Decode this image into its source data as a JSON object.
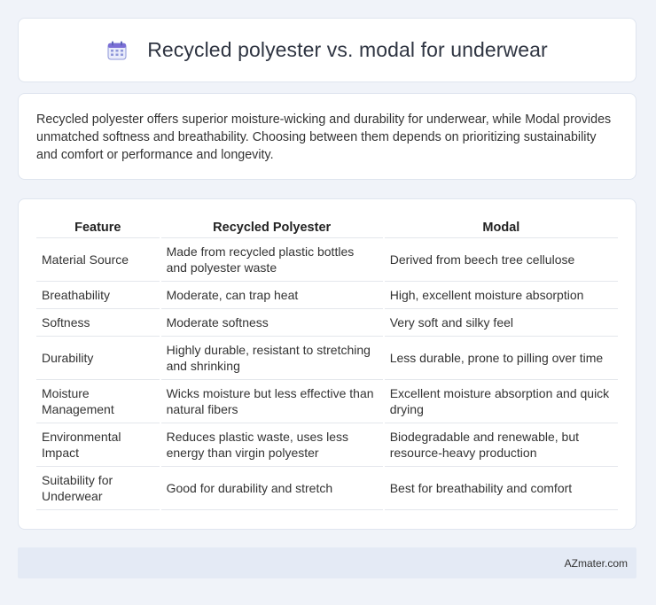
{
  "header": {
    "title": "Recycled polyester vs. modal for underwear",
    "icon": "calendar-icon"
  },
  "intro": {
    "text": "Recycled polyester offers superior moisture-wicking and durability for underwear, while Modal provides unmatched softness and breathability. Choosing between them depends on prioritizing sustainability and comfort or performance and longevity."
  },
  "table": {
    "headers": [
      "Feature",
      "Recycled Polyester",
      "Modal"
    ],
    "rows": [
      [
        "Material Source",
        "Made from recycled plastic bottles and polyester waste",
        "Derived from beech tree cellulose"
      ],
      [
        "Breathability",
        "Moderate, can trap heat",
        "High, excellent moisture absorption"
      ],
      [
        "Softness",
        "Moderate softness",
        "Very soft and silky feel"
      ],
      [
        "Durability",
        "Highly durable, resistant to stretching and shrinking",
        "Less durable, prone to pilling over time"
      ],
      [
        "Moisture Management",
        "Wicks moisture but less effective than natural fibers",
        "Excellent moisture absorption and quick drying"
      ],
      [
        "Environmental Impact",
        "Reduces plastic waste, uses less energy than virgin polyester",
        "Biodegradable and renewable, but resource-heavy production"
      ],
      [
        "Suitability for Underwear",
        "Good for durability and stretch",
        "Best for breathability and comfort"
      ]
    ]
  },
  "footer": {
    "site": "AZmater.com"
  },
  "colors": {
    "background": "#f0f3f9",
    "card": "#ffffff",
    "footer_bg": "#e4eaf5",
    "icon_accent": "#7b6fd6"
  }
}
